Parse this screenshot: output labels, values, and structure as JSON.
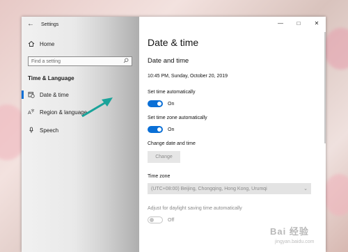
{
  "colors": {
    "accent": "#0a6fd6",
    "annotation_arrow": "#1aa39a"
  },
  "window": {
    "title": "Settings"
  },
  "sidebar": {
    "home_label": "Home",
    "search_placeholder": "Find a setting",
    "section_title": "Time & Language",
    "items": [
      {
        "label": "Date & time",
        "icon": "calendar-clock-icon",
        "selected": true
      },
      {
        "label": "Region & language",
        "icon": "globe-language-icon",
        "selected": false
      },
      {
        "label": "Speech",
        "icon": "microphone-icon",
        "selected": false
      }
    ]
  },
  "main": {
    "page_title": "Date & time",
    "section_title": "Date and time",
    "current_datetime": "10:45 PM, Sunday, October 20, 2019",
    "set_time_auto": {
      "label": "Set time automatically",
      "state": "On"
    },
    "set_timezone_auto": {
      "label": "Set time zone automatically",
      "state": "On"
    },
    "change_section_label": "Change date and time",
    "change_button": "Change",
    "time_zone": {
      "label": "Time zone",
      "value": "(UTC+08:00) Beijing, Chongqing, Hong Kong, Urumqi"
    },
    "daylight": {
      "label": "Adjust for daylight saving time automatically",
      "state": "Off"
    }
  },
  "watermark": {
    "text": "Bai 经验",
    "url": "jingyan.baidu.com"
  }
}
